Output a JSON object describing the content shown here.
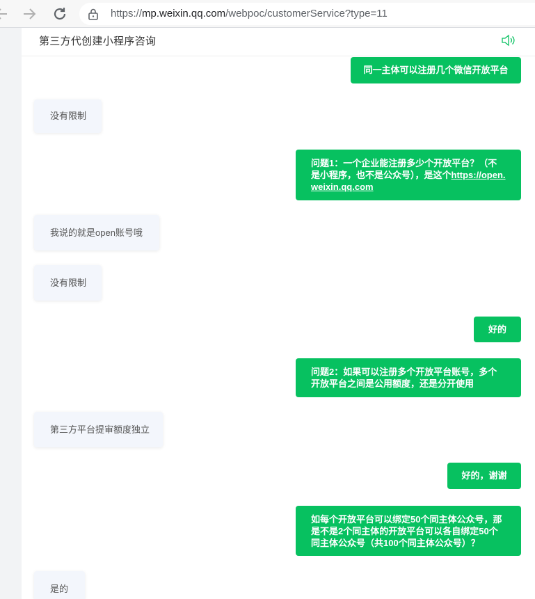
{
  "browser": {
    "url_prefix": "https://",
    "url_host": "mp.weixin.qq.com",
    "url_path": "/webpoc/customerService?type=11"
  },
  "header": {
    "title": "第三方代创建小程序咨询",
    "speaker_icon": "speaker-icon"
  },
  "messages": [
    {
      "from": "user",
      "text": "同一主体可以注册几个微信开放平台"
    },
    {
      "from": "service",
      "text": "没有限制"
    },
    {
      "from": "user",
      "text": "问题1：一个企业能注册多少个开放平台？（不是小程序，也不是公众号），是这个",
      "link": "https://open.weixin.qq.com"
    },
    {
      "from": "service",
      "text": "我说的就是open账号哦"
    },
    {
      "from": "service",
      "text": "没有限制"
    },
    {
      "from": "user",
      "text": "好的"
    },
    {
      "from": "user",
      "text": "问题2：如果可以注册多个开放平台账号，多个开放平台之间是公用额度，还是分开使用"
    },
    {
      "from": "service",
      "text": "第三方平台提审额度独立"
    },
    {
      "from": "user",
      "text": "好的，谢谢"
    },
    {
      "from": "user",
      "text": "如每个开放平台可以绑定50个同主体公众号，那是不是2个同主体的开放平台可以各自绑定50个同主体公众号（共100个同主体公众号）？"
    },
    {
      "from": "service",
      "text": "是的"
    }
  ],
  "colors": {
    "user_bubble": "#07c160",
    "service_bubble": "#f3f6fc",
    "page_bg": "#f2f3f5"
  }
}
